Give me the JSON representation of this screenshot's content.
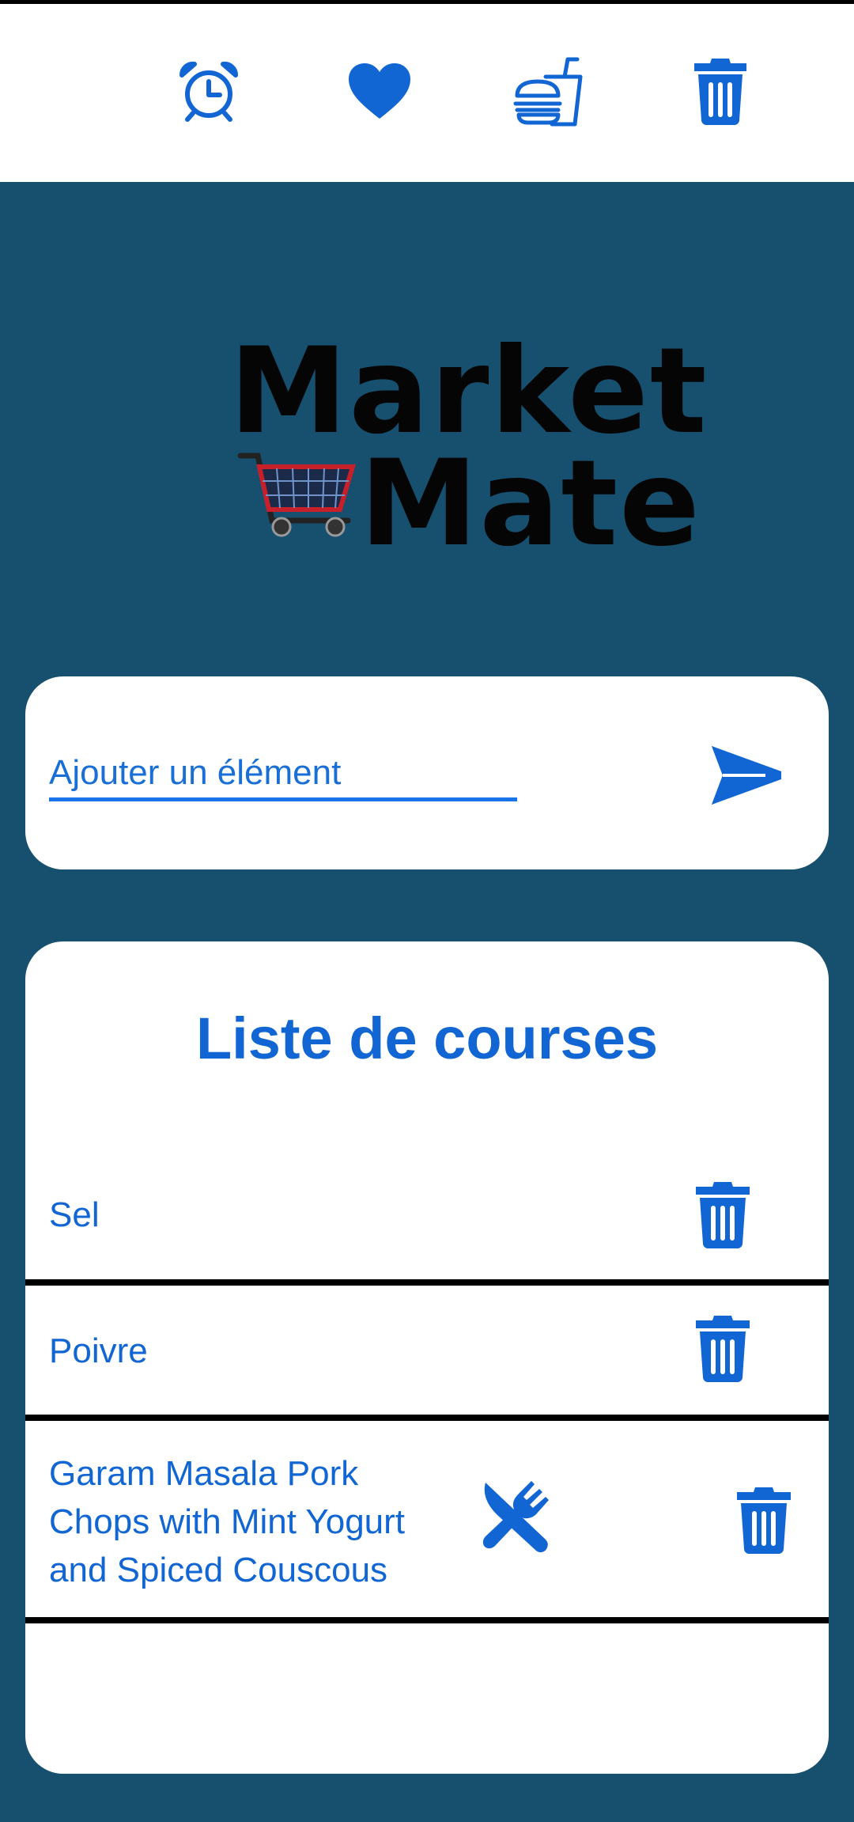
{
  "navbar": {
    "icons": [
      "alarm-clock-icon",
      "heart-icon",
      "burger-drink-icon",
      "trash-icon"
    ]
  },
  "logo": {
    "line1": "Market",
    "line2": "Mate"
  },
  "add_item": {
    "placeholder": "Ajouter un élément",
    "value": ""
  },
  "shopping_list": {
    "title": "Liste de courses",
    "items": [
      {
        "label": "Sel",
        "has_recipe": false
      },
      {
        "label": "Poivre",
        "has_recipe": false
      },
      {
        "label": "Garam Masala Pork Chops with Mint Yogurt and Spiced Couscous",
        "has_recipe": true
      }
    ]
  },
  "colors": {
    "background": "#17506f",
    "accent": "#1166d4",
    "card": "#ffffff",
    "divider": "#000000"
  }
}
